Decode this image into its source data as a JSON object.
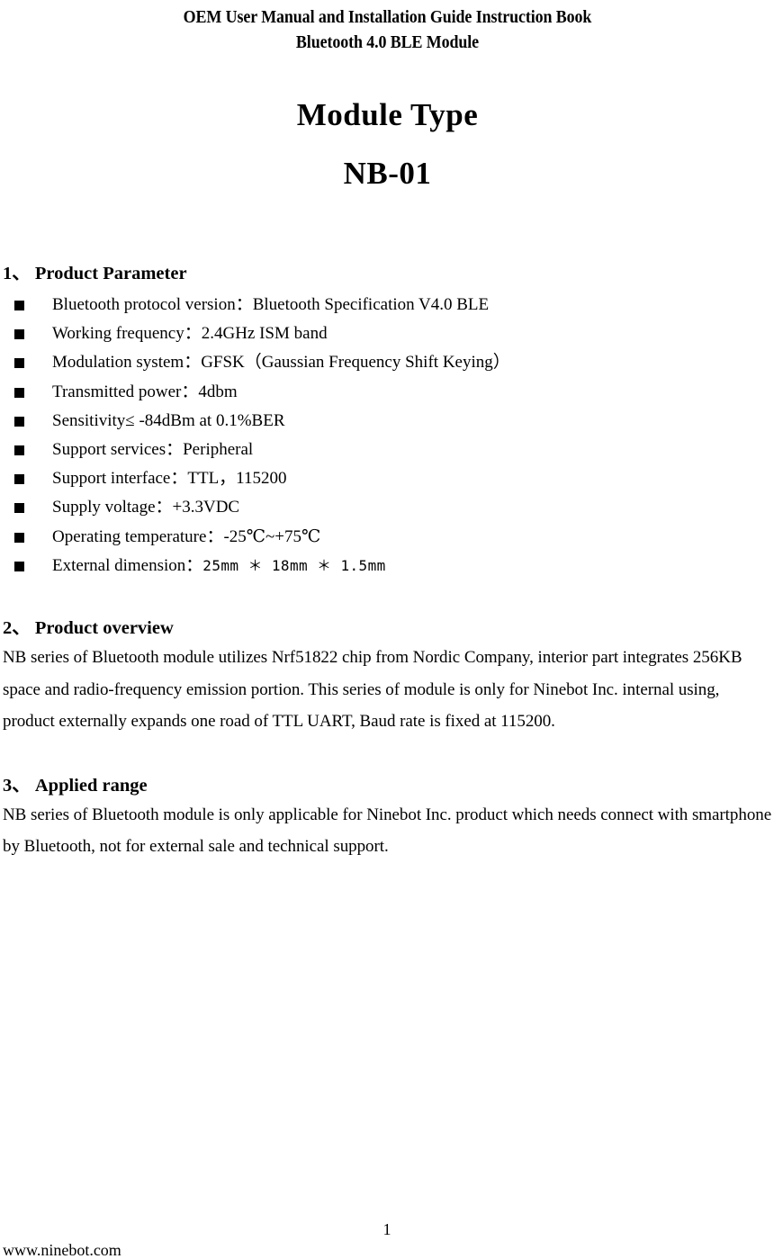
{
  "header": {
    "line1": "OEM User Manual and Installation Guide Instruction Book",
    "line2": "Bluetooth 4.0 BLE Module"
  },
  "module": {
    "type_label": "Module Type",
    "code": "NB-01"
  },
  "sections": [
    {
      "heading": "1、 Product Parameter",
      "bullets": [
        "Bluetooth protocol version：Bluetooth Specification V4.0 BLE",
        "Working frequency：2.4GHz ISM band",
        "Modulation system：GFSK（Gaussian Frequency Shift Keying）",
        "Transmitted power：4dbm",
        "Sensitivity≤ -84dBm at 0.1%BER",
        "Support services：Peripheral",
        "Support interface：TTL，115200",
        "Supply voltage：+3.3VDC",
        "Operating temperature：-25℃~+75℃"
      ],
      "dimension_bullet_label": "External dimension：",
      "dimension_bullet_value": "25mm ＊ 18mm ＊ 1.5mm"
    },
    {
      "heading": "2、 Product overview",
      "paragraph": "NB series of Bluetooth module utilizes Nrf51822 chip from Nordic Company, interior part integrates 256KB space and radio-frequency emission portion. This series of module is only for Ninebot Inc. internal using, product externally expands one road of TTL UART, Baud rate is fixed at 115200."
    },
    {
      "heading": "3、 Applied range",
      "paragraph": "NB series of Bluetooth module is only applicable for Ninebot Inc. product which needs connect with smartphone by Bluetooth, not for external sale and technical support."
    }
  ],
  "footer": {
    "page_number": "1",
    "website": "www.ninebot.com"
  }
}
